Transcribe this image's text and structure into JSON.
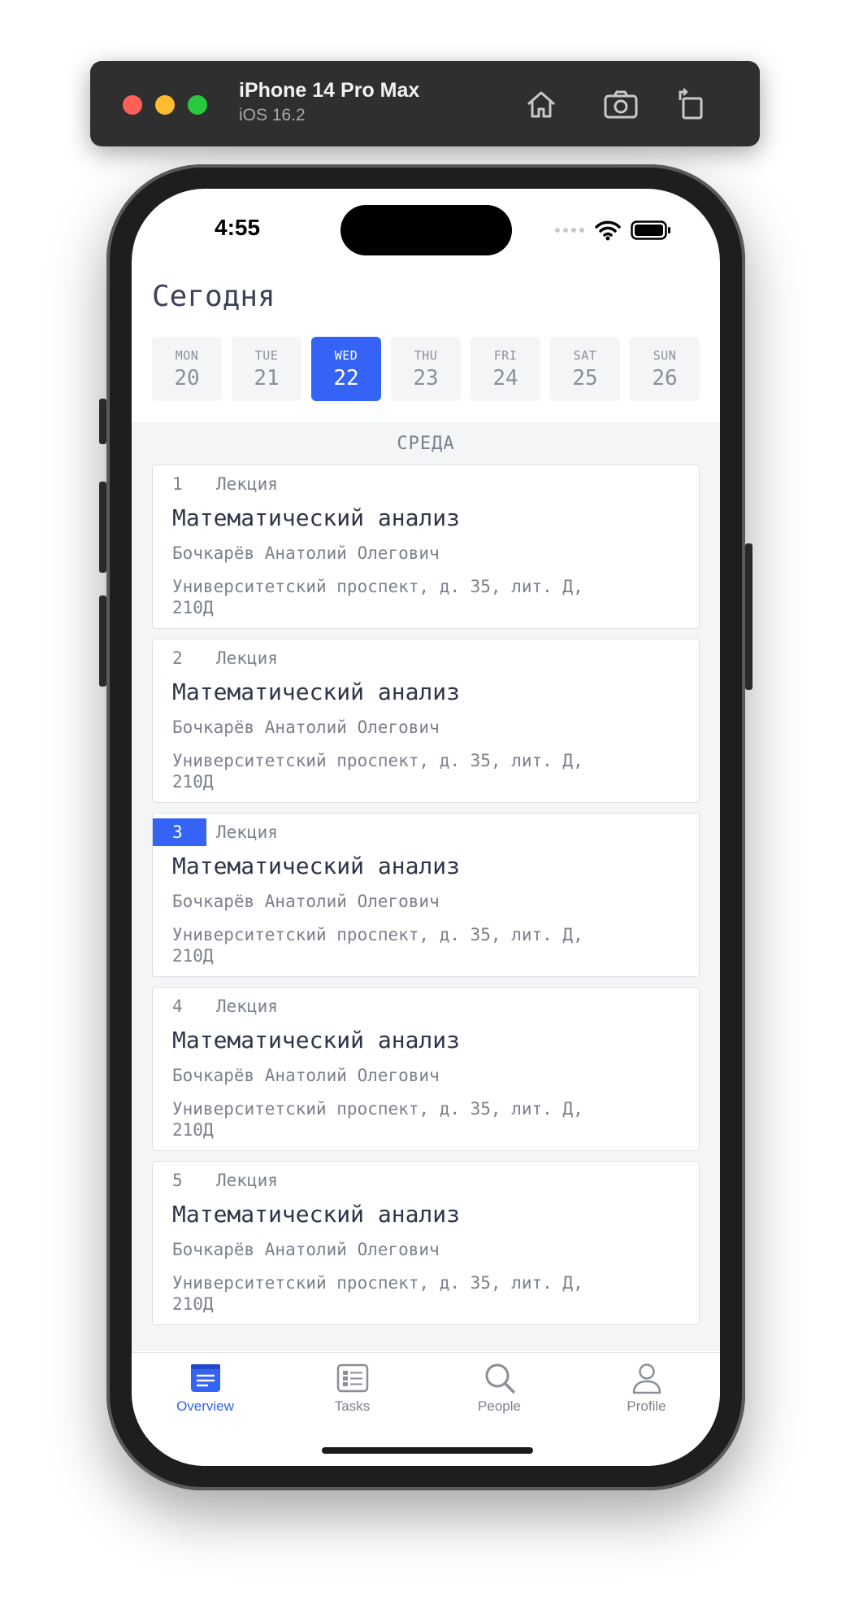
{
  "simulator": {
    "device_name": "iPhone 14 Pro Max",
    "os_version": "iOS 16.2",
    "buttons": [
      "home-icon",
      "screenshot-icon",
      "rotate-icon"
    ]
  },
  "status_bar": {
    "time": "4:55"
  },
  "header": {
    "title": "Сегодня"
  },
  "week": [
    {
      "name": "MON",
      "date": "20"
    },
    {
      "name": "TUE",
      "date": "21"
    },
    {
      "name": "WED",
      "date": "22",
      "selected": true
    },
    {
      "name": "THU",
      "date": "23"
    },
    {
      "name": "FRI",
      "date": "24"
    },
    {
      "name": "SAT",
      "date": "25"
    },
    {
      "name": "SUN",
      "date": "26"
    }
  ],
  "schedule": {
    "weekday_label": "СРЕДА",
    "lessons": [
      {
        "number": "1",
        "type": "Лекция",
        "subject": "Математический анализ",
        "teacher": "Бочкарёв Анатолий Олегович",
        "place": "Университетский проспект, д. 35, лит. Д, 210Д"
      },
      {
        "number": "2",
        "type": "Лекция",
        "subject": "Математический анализ",
        "teacher": "Бочкарёв Анатолий Олегович",
        "place": "Университетский проспект, д. 35, лит. Д, 210Д"
      },
      {
        "number": "3",
        "type": "Лекция",
        "subject": "Математический анализ",
        "teacher": "Бочкарёв Анатолий Олегович",
        "place": "Университетский проспект, д. 35, лит. Д, 210Д",
        "current": true
      },
      {
        "number": "4",
        "type": "Лекция",
        "subject": "Математический анализ",
        "teacher": "Бочкарёв Анатолий Олегович",
        "place": "Университетский проспект, д. 35, лит. Д, 210Д"
      },
      {
        "number": "5",
        "type": "Лекция",
        "subject": "Математический анализ",
        "teacher": "Бочкарёв Анатолий Олегович",
        "place": "Университетский проспект, д. 35, лит. Д, 210Д"
      }
    ]
  },
  "tabbar": {
    "tabs": [
      {
        "label": "Overview",
        "icon": "overview-icon",
        "active": true
      },
      {
        "label": "Tasks",
        "icon": "tasks-icon"
      },
      {
        "label": "People",
        "icon": "search-icon"
      },
      {
        "label": "Profile",
        "icon": "profile-icon"
      }
    ]
  },
  "colors": {
    "accent": "#3563f5",
    "text_primary": "#2f3548",
    "text_secondary": "#7b818c",
    "background": "#f4f5f6"
  }
}
